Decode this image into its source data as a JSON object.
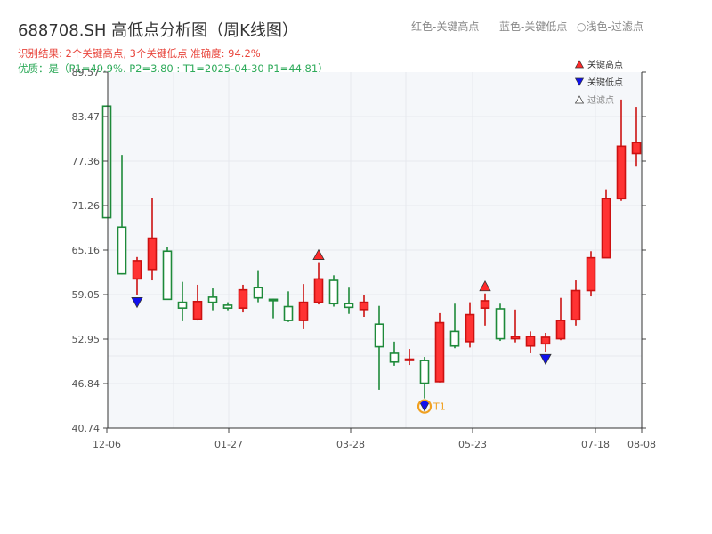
{
  "header": {
    "title": "688708.SH 高低点分析图（周K线图）",
    "result_line": "识别结果: 2个关键高点, 3个关键低点  准确度: 94.2%",
    "quality_line": "优质：是（P1=49.9%, P2=3.80 ; T1=2025-04-30 P1=44.81）"
  },
  "top_legend": {
    "red": "红色-关键高点",
    "blue": "蓝色-关键低点",
    "filtered": "浅色-过滤点",
    "filtered_symbol": "○"
  },
  "colors": {
    "up": "#ff3333",
    "up_border": "#cc1111",
    "down": "#1e8a3a",
    "high_marker": "#ff2a2a",
    "low_marker": "#1010ee",
    "t1": "#f0a020",
    "grid": "#e6e9ee",
    "plot_bg": "#f5f7fa"
  },
  "chart_data": {
    "type": "candlestick",
    "ylim": [
      40.74,
      89.57
    ],
    "y_ticks": [
      "40.74",
      "46.84",
      "52.95",
      "59.05",
      "65.16",
      "71.26",
      "77.36",
      "83.47",
      "89.57"
    ],
    "x_ticks": [
      "12-06",
      "01-27",
      "03-28",
      "05-23",
      "07-18",
      "08-08"
    ],
    "legend": [
      {
        "label": "关键高点",
        "marker": "triangle-up",
        "color": "#ff2a2a"
      },
      {
        "label": "关键低点",
        "marker": "triangle-down",
        "color": "#1010ee"
      },
      {
        "label": "过滤点",
        "marker": "triangle-up-hollow",
        "color": "#999999"
      }
    ],
    "ohlc": [
      [
        84.9,
        85.0,
        69.6,
        69.6
      ],
      [
        68.3,
        78.2,
        61.8,
        61.9
      ],
      [
        61.2,
        64.2,
        59.0,
        63.7
      ],
      [
        62.5,
        72.3,
        61.0,
        66.8
      ],
      [
        65.0,
        65.6,
        58.4,
        58.4
      ],
      [
        58.0,
        60.8,
        55.4,
        57.2
      ],
      [
        55.7,
        60.4,
        55.5,
        58.1
      ],
      [
        58.7,
        59.9,
        56.9,
        58.0
      ],
      [
        57.6,
        58.0,
        56.9,
        57.2
      ],
      [
        57.2,
        60.4,
        56.6,
        59.7
      ],
      [
        60.0,
        62.4,
        58.0,
        58.6
      ],
      [
        58.4,
        58.5,
        55.8,
        58.3
      ],
      [
        57.4,
        59.5,
        55.3,
        55.5
      ],
      [
        55.5,
        60.5,
        54.3,
        58.0
      ],
      [
        58.0,
        63.5,
        57.7,
        61.2
      ],
      [
        61.0,
        61.7,
        57.4,
        57.8
      ],
      [
        57.8,
        60.0,
        56.4,
        57.3
      ],
      [
        57.0,
        59.0,
        56.0,
        58.0
      ],
      [
        55.0,
        57.5,
        46.0,
        51.9
      ],
      [
        51.0,
        52.6,
        49.3,
        49.8
      ],
      [
        50.2,
        51.6,
        49.4,
        50.2
      ],
      [
        50.0,
        50.5,
        44.81,
        46.9
      ],
      [
        47.1,
        56.5,
        47.0,
        55.2
      ],
      [
        54.0,
        57.8,
        51.7,
        52.0
      ],
      [
        52.6,
        58.0,
        51.8,
        56.3
      ],
      [
        57.2,
        59.2,
        54.8,
        58.2
      ],
      [
        57.1,
        57.8,
        52.7,
        53.0
      ],
      [
        53.0,
        57.0,
        52.5,
        53.3
      ],
      [
        52.0,
        54.0,
        51.0,
        53.3
      ],
      [
        52.3,
        53.8,
        51.2,
        53.2
      ],
      [
        53.0,
        58.6,
        52.8,
        55.5
      ],
      [
        55.6,
        61.0,
        54.8,
        59.6
      ],
      [
        59.6,
        65.0,
        58.8,
        64.1
      ],
      [
        64.1,
        73.5,
        64.1,
        72.2
      ],
      [
        72.2,
        85.8,
        71.9,
        79.4
      ],
      [
        78.4,
        84.8,
        76.6,
        79.9
      ]
    ],
    "key_highs": [
      {
        "index": 14,
        "price": 63.5
      },
      {
        "index": 25,
        "price": 59.2
      }
    ],
    "key_lows": [
      {
        "index": 2,
        "price": 59.0
      },
      {
        "index": 21,
        "price": 44.81
      },
      {
        "index": 29,
        "price": 51.2
      }
    ],
    "t1": {
      "index": 21,
      "label": "T1"
    }
  }
}
